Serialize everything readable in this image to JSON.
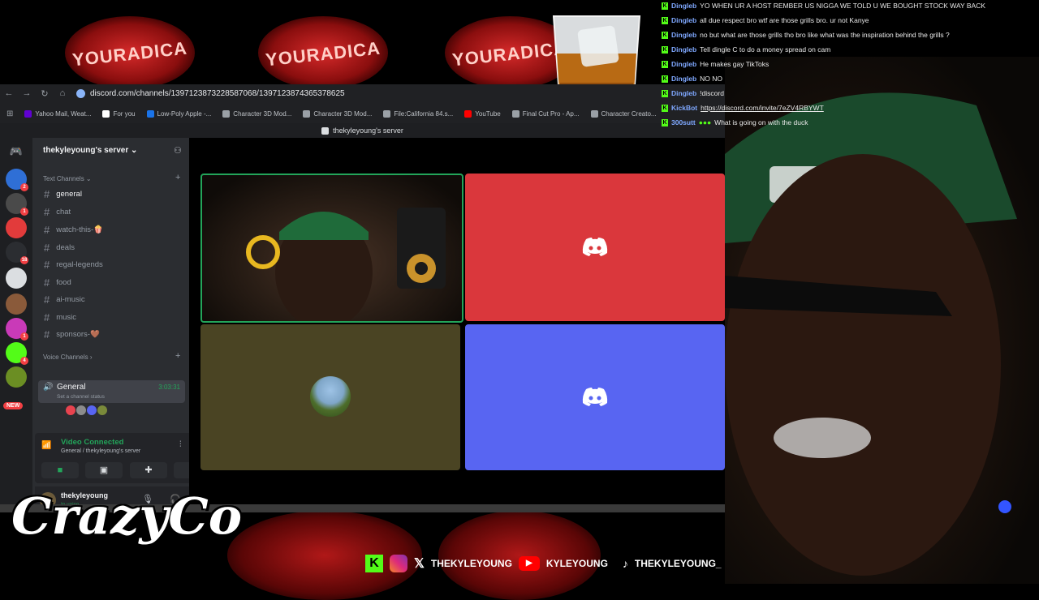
{
  "banners": {
    "text": "YOURADICA"
  },
  "browser": {
    "url": "discord.com/channels/1397123873228587068/1397123874365378625",
    "bookmarks": [
      {
        "label": "Yahoo Mail, Weat...",
        "color": "#6001d2"
      },
      {
        "label": "For you",
        "color": "#ffffff"
      },
      {
        "label": "Low-Poly Apple -...",
        "color": "#1a73e8"
      },
      {
        "label": "Character 3D Mod...",
        "color": "#9aa0a6"
      },
      {
        "label": "Character 3D Mod...",
        "color": "#9aa0a6"
      },
      {
        "label": "File:California 84.s...",
        "color": "#9aa0a6"
      },
      {
        "label": "YouTube",
        "color": "#ff0000"
      },
      {
        "label": "Final Cut Pro - Ap...",
        "color": "#9aa0a6"
      },
      {
        "label": "Character Creato...",
        "color": "#9aa0a6"
      }
    ]
  },
  "discord": {
    "window_title": "thekyleyoung's server",
    "server_name": "thekyleyoung's server",
    "text_channels_label": "Text Channels",
    "voice_channels_label": "Voice Channels",
    "text_channels": [
      "general",
      "chat",
      "watch-this-🍿",
      "deals",
      "regal-legends",
      "food",
      "ai-music",
      "music",
      "sponsors-🤎"
    ],
    "voice_channel": {
      "name": "General",
      "timer": "3:03:31",
      "status_hint": "Set a channel status"
    },
    "server_badges": [
      "2",
      "1",
      "",
      "",
      "18",
      "",
      "",
      "1",
      "4",
      "",
      "",
      "NEW"
    ],
    "voice_connected": {
      "title": "Video Connected",
      "subtitle": "General / thekyleyoung's server"
    },
    "user": {
      "name": "thekyleyoung",
      "status": "In voice"
    }
  },
  "chat": [
    {
      "name": "Dingleb",
      "msg": "YO WHEN UR A HOST REMBER US NIGGA WE TOLD U WE BOUGHT STOCK WAY BACK"
    },
    {
      "name": "Dingleb",
      "msg": "all due respect bro wtf are those grills bro. ur not Kanye"
    },
    {
      "name": "Dingleb",
      "msg": "no but what are those grills tho bro like what was the inspiration behind the grills ?"
    },
    {
      "name": "Dingleb",
      "msg": "Tell dingle C to do a money spread on cam"
    },
    {
      "name": "Dingleb",
      "msg": "He makes gay TikToks"
    },
    {
      "name": "Dingleb",
      "msg": "NO NO"
    },
    {
      "name": "Dingleb",
      "msg": "!discord"
    },
    {
      "name": "KickBot",
      "msg": "https://discord.com/invite/7eZV4RBYWT"
    },
    {
      "name": "300sutt",
      "msg": "What is going on with the duck"
    }
  ],
  "brand": {
    "name": "CrazyCo"
  },
  "socials": {
    "x_handle": "THEKYLEYOUNG",
    "youtube_handle": "KYLEYOUNG",
    "tiktok_handle": "THEKYLEYOUNG_"
  },
  "colors": {
    "discord_red": "#da373c",
    "discord_blurple": "#5865f2",
    "olive_tile": "#4a4423",
    "kick_green": "#53fc18",
    "active_speaker": "#23a55a"
  }
}
